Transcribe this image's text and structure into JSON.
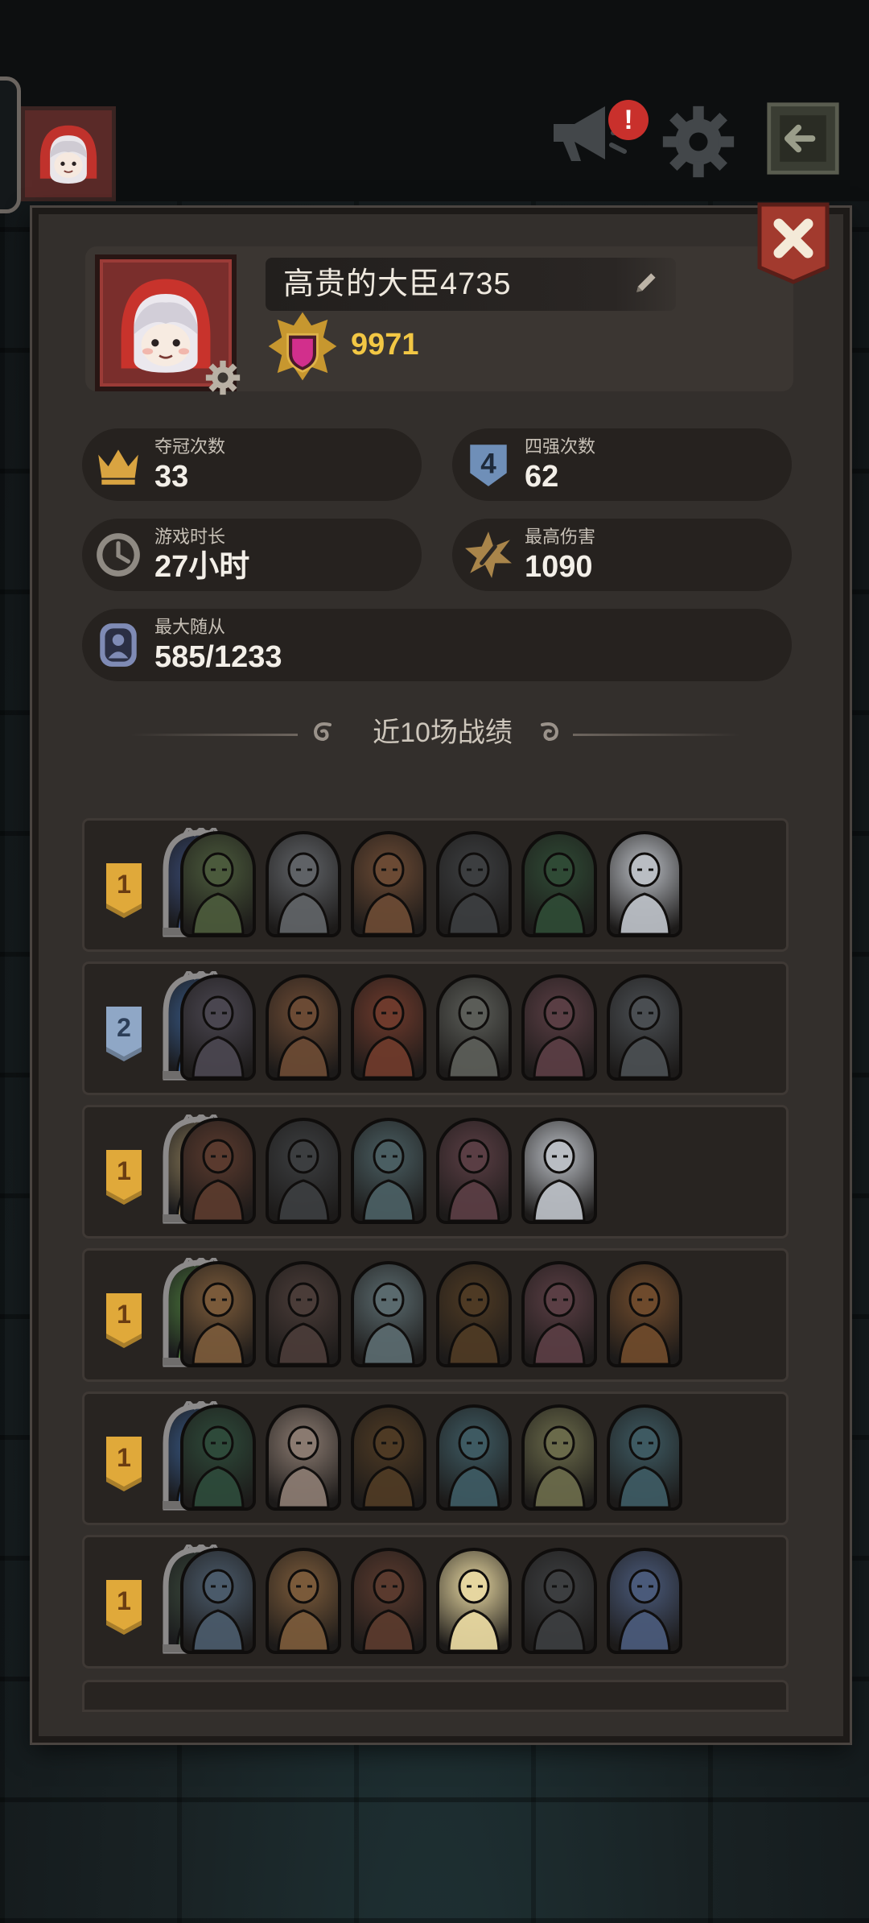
{
  "topbar": {
    "icons": [
      "avatar",
      "announcement-icon",
      "settings-gear-icon",
      "exit-icon"
    ],
    "notification_mark": "!"
  },
  "profile": {
    "name": "高贵的大臣4735",
    "rank_score": "9971",
    "avatar_icon": "red-hood-girl-avatar",
    "settings_icon": "gear-icon",
    "edit_icon": "pencil-icon"
  },
  "stats": [
    {
      "label": "夺冠次数",
      "value": "33",
      "icon": "crown-icon"
    },
    {
      "label": "四强次数",
      "value": "62",
      "icon": "top4-shield-icon"
    },
    {
      "label": "游戏时长",
      "value": "27小时",
      "icon": "clock-icon"
    },
    {
      "label": "最高伤害",
      "value": "1090",
      "icon": "damage-burst-icon"
    },
    {
      "label": "最大随从",
      "value": "585/1233",
      "icon": "minion-portrait-icon"
    }
  ],
  "history": {
    "title": "近10场战绩",
    "matches": [
      {
        "place": "1",
        "hero_color": "#3c4e7a",
        "minions": [
          "#4b5a3c",
          "#5f6266",
          "#6b4a34",
          "#3c3e40",
          "#2f4a35",
          "#b9bdc3"
        ]
      },
      {
        "place": "2",
        "hero_color": "#3a5c8a",
        "minions": [
          "#4a4650",
          "#6b4a34",
          "#6e3a2c",
          "#5b5d58",
          "#5a3e44",
          "#4a4e52"
        ]
      },
      {
        "place": "1",
        "hero_color": "#8b7a58",
        "minions": [
          "#5a3a2e",
          "#3c3e40",
          "#4a5e62",
          "#5a3e44",
          "#b9bdc3"
        ]
      },
      {
        "place": "1",
        "hero_color": "#4d7a3c",
        "minions": [
          "#7a5a3a",
          "#4a3c38",
          "#5a6a6e",
          "#4e3a24",
          "#5a3e44",
          "#6e4a2c"
        ]
      },
      {
        "place": "1",
        "hero_color": "#3a5c8a",
        "minions": [
          "#2e4a3a",
          "#8a7a70",
          "#4e3a24",
          "#3e5a62",
          "#6a6a4a",
          "#3e5a62"
        ]
      },
      {
        "place": "1",
        "hero_color": "#3b4a3c",
        "minions": [
          "#4a5a6a",
          "#7a5a3a",
          "#5a3a2e",
          "#e6d6a0",
          "#3c3e40",
          "#4a5a7a"
        ]
      }
    ]
  },
  "colors": {
    "panel": "#332f2c",
    "gold": "#f2c744",
    "place_gold": "#e0a93a",
    "place_silver": "#8fa7c6"
  }
}
